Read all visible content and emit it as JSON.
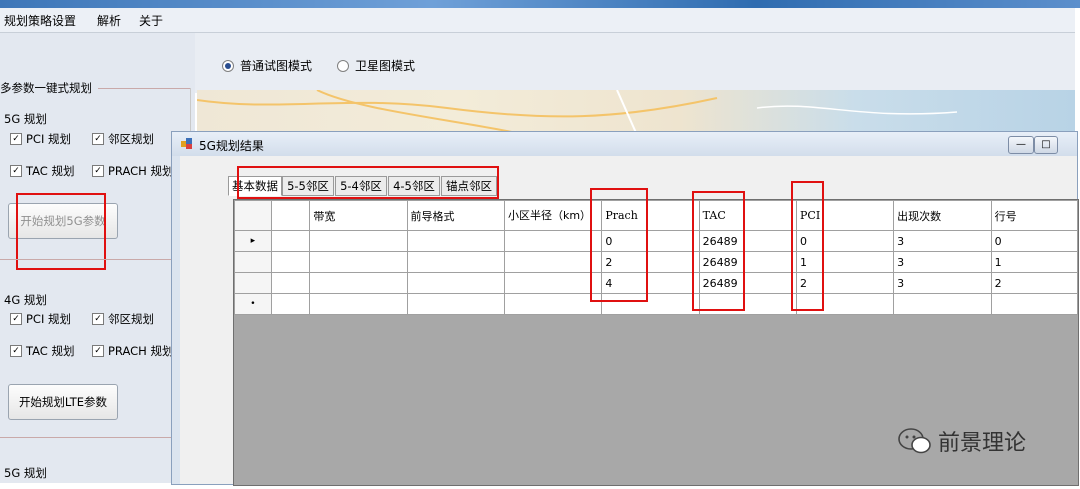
{
  "menu": [
    "规划策略设置",
    "解析",
    "关于"
  ],
  "view_mode": {
    "options": [
      "普通试图模式",
      "卫星图模式"
    ],
    "selected": "普通试图模式"
  },
  "left_panel": {
    "group_title": "多参数一键式规划",
    "sec5g": {
      "title": "5G 规划",
      "checks": [
        "PCI 规划",
        "邻区规划",
        "TAC 规划",
        "PRACH 规划"
      ],
      "button": "开始规划5G参数"
    },
    "sec4g": {
      "title": "4G 规划",
      "checks": [
        "PCI 规划",
        "邻区规划",
        "TAC 规划",
        "PRACH 规划"
      ],
      "button": "开始规划LTE参数"
    },
    "sec_bottom_title": "5G 规划"
  },
  "dialog": {
    "title": "5G规划结果",
    "tabs": [
      "基本数据",
      "5-5邻区",
      "5-4邻区",
      "4-5邻区",
      "锚点邻区"
    ],
    "active_tab": "基本数据",
    "columns": [
      "带宽",
      "前导格式",
      "小区半径（km）",
      "Prach",
      "TAC",
      "PCI",
      "出现次数",
      "行号"
    ],
    "rows": [
      {
        "bandwidth": "",
        "preamble": "",
        "radius": "",
        "prach": "0",
        "tac": "26489",
        "pci": "0",
        "count": "3",
        "row": "0"
      },
      {
        "bandwidth": "",
        "preamble": "",
        "radius": "",
        "prach": "2",
        "tac": "26489",
        "pci": "1",
        "count": "3",
        "row": "1"
      },
      {
        "bandwidth": "",
        "preamble": "",
        "radius": "",
        "prach": "4",
        "tac": "26489",
        "pci": "2",
        "count": "3",
        "row": "2"
      }
    ],
    "current_row_marker": "▸",
    "new_row_marker": "•"
  },
  "watermark": "前景理论",
  "colors": {
    "highlight": "#e01010",
    "grid_empty": "#a8a8a8"
  }
}
